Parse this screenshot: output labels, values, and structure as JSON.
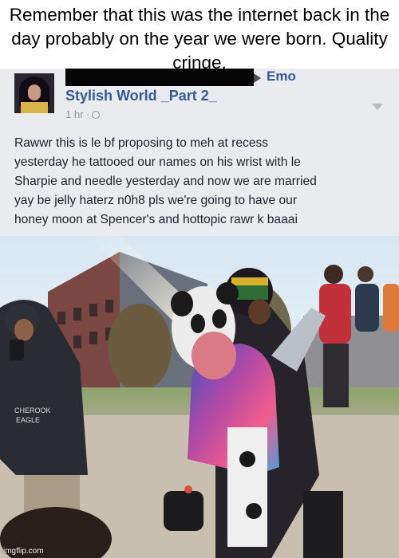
{
  "meme": {
    "caption": "Remember that this was the internet back in the day probably on the year we were born. Quality cringe.",
    "watermark": "imgflip.com"
  },
  "post": {
    "group_name": "Emo",
    "page_name": "Stylish World _Part 2_",
    "timestamp": "1 hr ·",
    "body": "Rawwr this is le bf proposing to meh at recess\nyesterday he tattooed our names on his wrist with le\nSharpie and needle yesterday and now we are married\nyay be jelly haterz n0h8 pls we're going to have our\nhoney moon at Spencer's and hottopic rawr k baaai",
    "photo": {
      "description_icon": "photo-icon",
      "shirt_text": "CHEROOK\nEAGLE"
    }
  },
  "colors": {
    "link_blue": "#365899",
    "meta_gray": "#90949c",
    "text": "#1d2129",
    "post_bg": "#e9ebee"
  }
}
